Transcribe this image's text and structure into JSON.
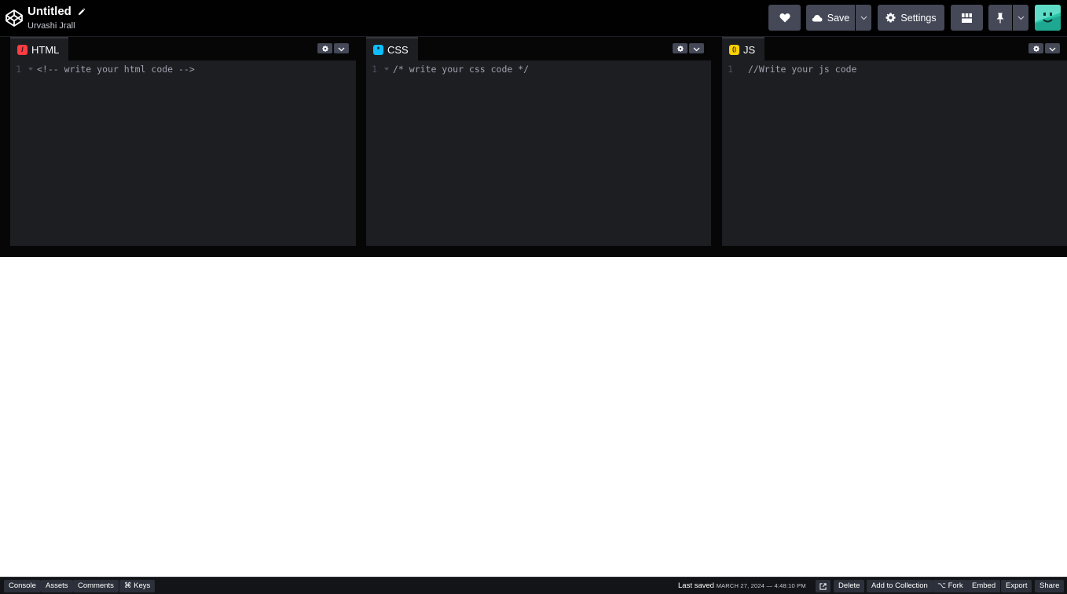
{
  "header": {
    "title": "Untitled",
    "author": "Urvashi Jrall",
    "save_label": "Save",
    "settings_label": "Settings"
  },
  "panes": [
    {
      "label": "HTML",
      "icon": "/",
      "icon_color": "#ff3c41",
      "line": "1",
      "code": "<!-- write your html code -->"
    },
    {
      "label": "CSS",
      "icon": "*",
      "icon_color": "#0ebeff",
      "line": "1",
      "code": "/* write your css code */"
    },
    {
      "label": "JS",
      "icon": "()",
      "icon_color": "#fcd000",
      "line": "1",
      "code": "//Write your js code"
    }
  ],
  "footer": {
    "console": "Console",
    "assets": "Assets",
    "comments": "Comments",
    "keys": "⌘ Keys",
    "last_saved_label": "Last saved",
    "last_saved_time": "MARCH 27, 2024 — 4:48:10 PM",
    "delete": "Delete",
    "add_to_collection": "Add to Collection",
    "fork": "⌥ Fork",
    "embed": "Embed",
    "export": "Export",
    "share": "Share"
  }
}
